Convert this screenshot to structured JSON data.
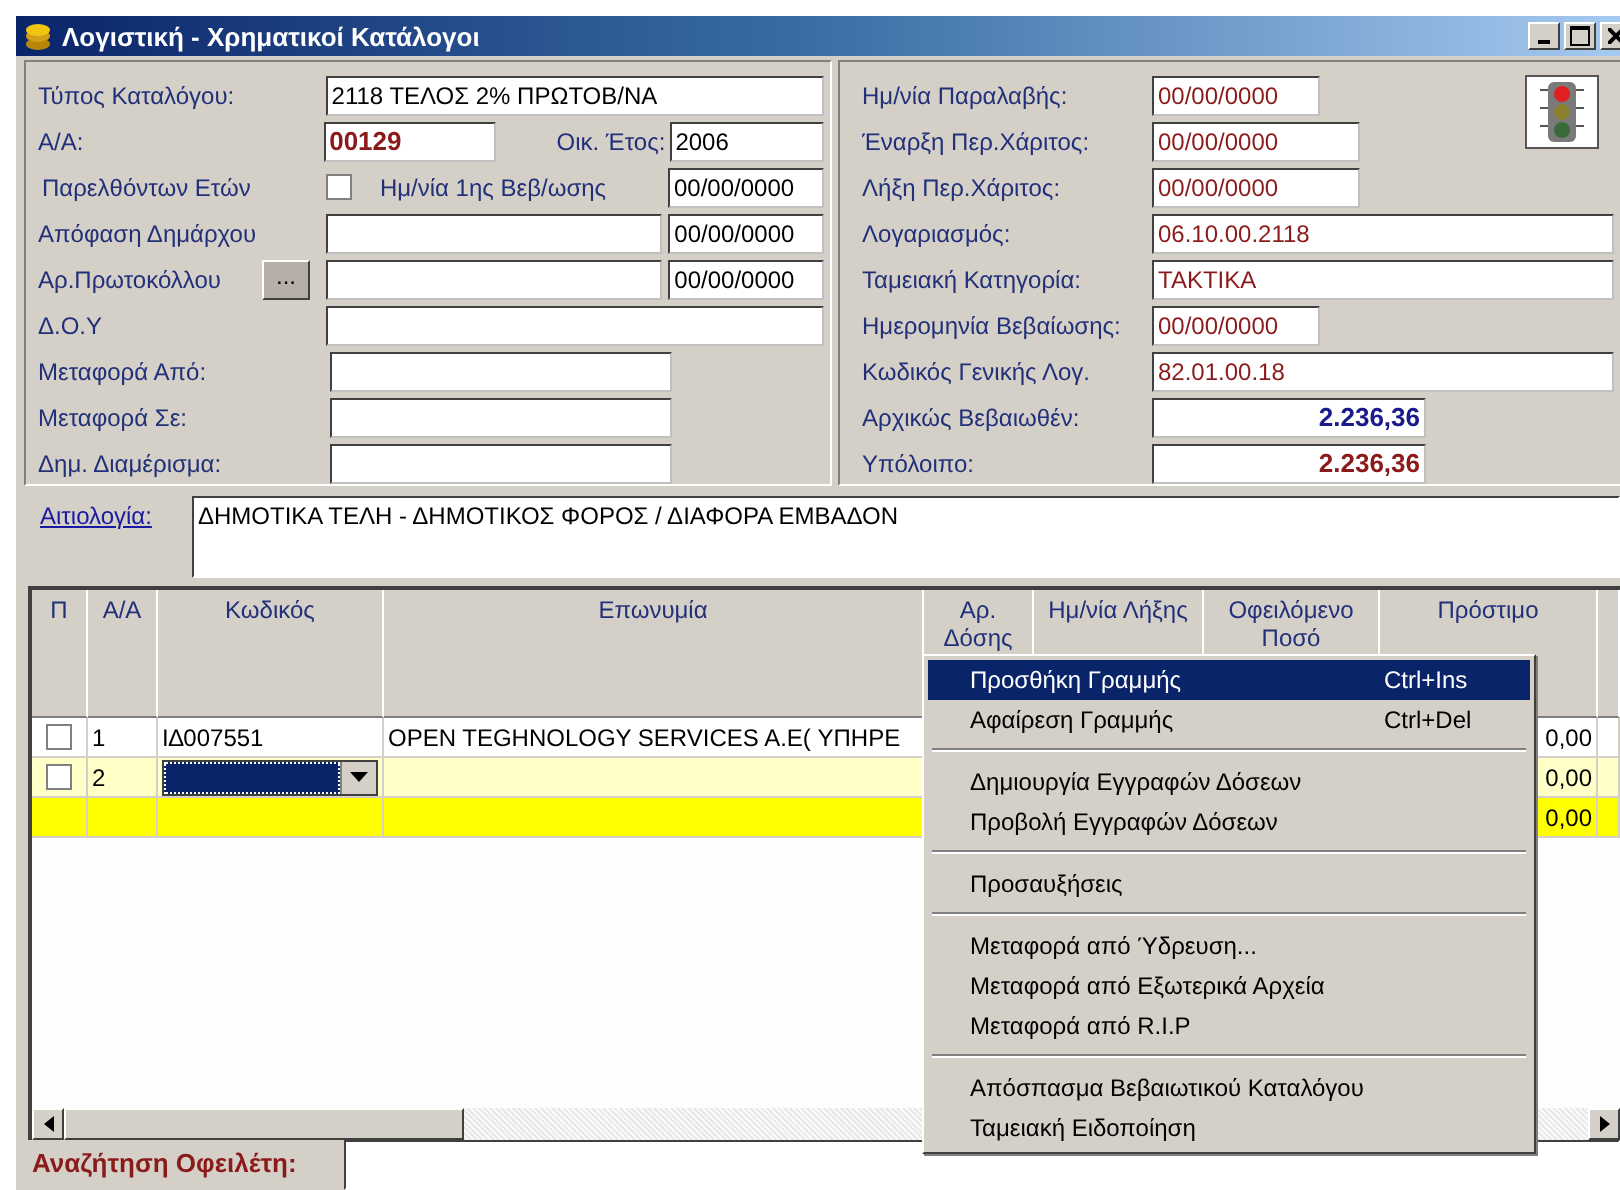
{
  "window": {
    "title": "Λογιστική - Χρηματικοί Κατάλογοι"
  },
  "left_form": {
    "catalog_type": {
      "label": "Τύπος Καταλόγου:",
      "value": "2118 ΤΕΛΟΣ 2% ΠΡΩΤΟΒ/ΝΑ"
    },
    "aa": {
      "label": "Α/Α:",
      "value": "00129"
    },
    "fiscal_year": {
      "label": "Οικ. Έτος:",
      "value": "2006"
    },
    "previous_years": {
      "label": "Παρελθόντων Ετών",
      "checked": false
    },
    "first_cert_date": {
      "label": "Ημ/νία 1ης Βεβ/ωσης",
      "value": "00/00/0000"
    },
    "mayor_decision": {
      "label": "Απόφαση Δημάρχου",
      "date": "00/00/0000"
    },
    "protocol_no": {
      "label": "Αρ.Πρωτοκόλλου",
      "button": "...",
      "date": "00/00/0000"
    },
    "tax_office": {
      "label": "Δ.Ο.Υ"
    },
    "transfer_from": {
      "label": "Μεταφορά Από:"
    },
    "transfer_to": {
      "label": "Μεταφορά Σε:"
    },
    "district": {
      "label": "Δημ. Διαμέρισμα:"
    }
  },
  "right_form": [
    {
      "label": "Ημ/νία Παραλαβής:",
      "value": "00/00/0000",
      "kind": "date"
    },
    {
      "label": "Έναρξη Περ.Χάριτος:",
      "value": "00/00/0000",
      "kind": "mid"
    },
    {
      "label": "Λήξη Περ.Χάριτος:",
      "value": "00/00/0000",
      "kind": "mid"
    },
    {
      "label": "Λογαριασμός:",
      "value": "06.10.00.2118",
      "kind": "long"
    },
    {
      "label": "Ταμειακή Κατηγορία:",
      "value": "ΤΑΚΤΙΚΑ",
      "kind": "long"
    },
    {
      "label": "Ημερομηνία Βεβαίωσης:",
      "value": "00/00/0000",
      "kind": "date"
    },
    {
      "label": "Κωδικός Γενικής Λογ.",
      "value": "82.01.00.18",
      "kind": "long"
    },
    {
      "label": "Αρχικώς Βεβαιωθέν:",
      "value": "2.236,36",
      "kind": "amount",
      "color": "#1a1a8c"
    },
    {
      "label": "Υπόλοιπο:",
      "value": "2.236,36",
      "kind": "amount",
      "color": "#8b1a1a"
    }
  ],
  "reason": {
    "label": "Αιτιολογία:",
    "value": "ΔΗΜΟΤΙΚΑ ΤΕΛΗ - ΔΗΜΟΤΙΚΟΣ ΦΟΡΟΣ  /  ΔΙΑΦΟΡΑ ΕΜΒΑΔΟΝ"
  },
  "table": {
    "columns": [
      "Π",
      "Α/Α",
      "Κωδικός",
      "Επωνυμία",
      "Αρ. Δόσης",
      "Ημ/νία Λήξης",
      "Οφειλόμενο Ποσό",
      "Πρόστιμο"
    ],
    "rows": [
      {
        "kind": "normal",
        "selected": false,
        "checked": false,
        "aa": "1",
        "code": "Ι∆007551",
        "name": "OPEN TEGHNOLOGY SERVICES A.E( ΥΠΗΡΕ",
        "fine": "0,00"
      },
      {
        "kind": "normal",
        "selected": true,
        "checked": false,
        "aa": "2",
        "fine": "0,00"
      },
      {
        "kind": "new",
        "selected": false,
        "fine": "0,00"
      }
    ]
  },
  "context_menu": {
    "groups": [
      [
        {
          "label": "Προσθήκη Γραμμής",
          "shortcut": "Ctrl+Ins",
          "selected": true
        },
        {
          "label": "Αφαίρεση Γραμμής",
          "shortcut": "Ctrl+Del",
          "selected": false
        }
      ],
      [
        {
          "label": "Δημιουργία Εγγραφών Δόσεων",
          "selected": false
        },
        {
          "label": "Προβολή Εγγραφών Δόσεων",
          "selected": false
        }
      ],
      [
        {
          "label": "Προσαυξήσεις",
          "selected": false
        }
      ],
      [
        {
          "label": "Μεταφορά από Ύδρευση...",
          "selected": false
        },
        {
          "label": "Μεταφορά από Εξωτερικά Αρχεία",
          "selected": false
        },
        {
          "label": "Μεταφορά από R.I.P",
          "selected": false
        }
      ],
      [
        {
          "label": "Απόσπασμα Βεβαιωτικού Καταλόγου",
          "selected": false
        },
        {
          "label": "Ταμειακή Ειδοποίηση",
          "selected": false
        }
      ]
    ]
  },
  "search": {
    "label": "Αναζήτηση Οφειλέτη:"
  }
}
